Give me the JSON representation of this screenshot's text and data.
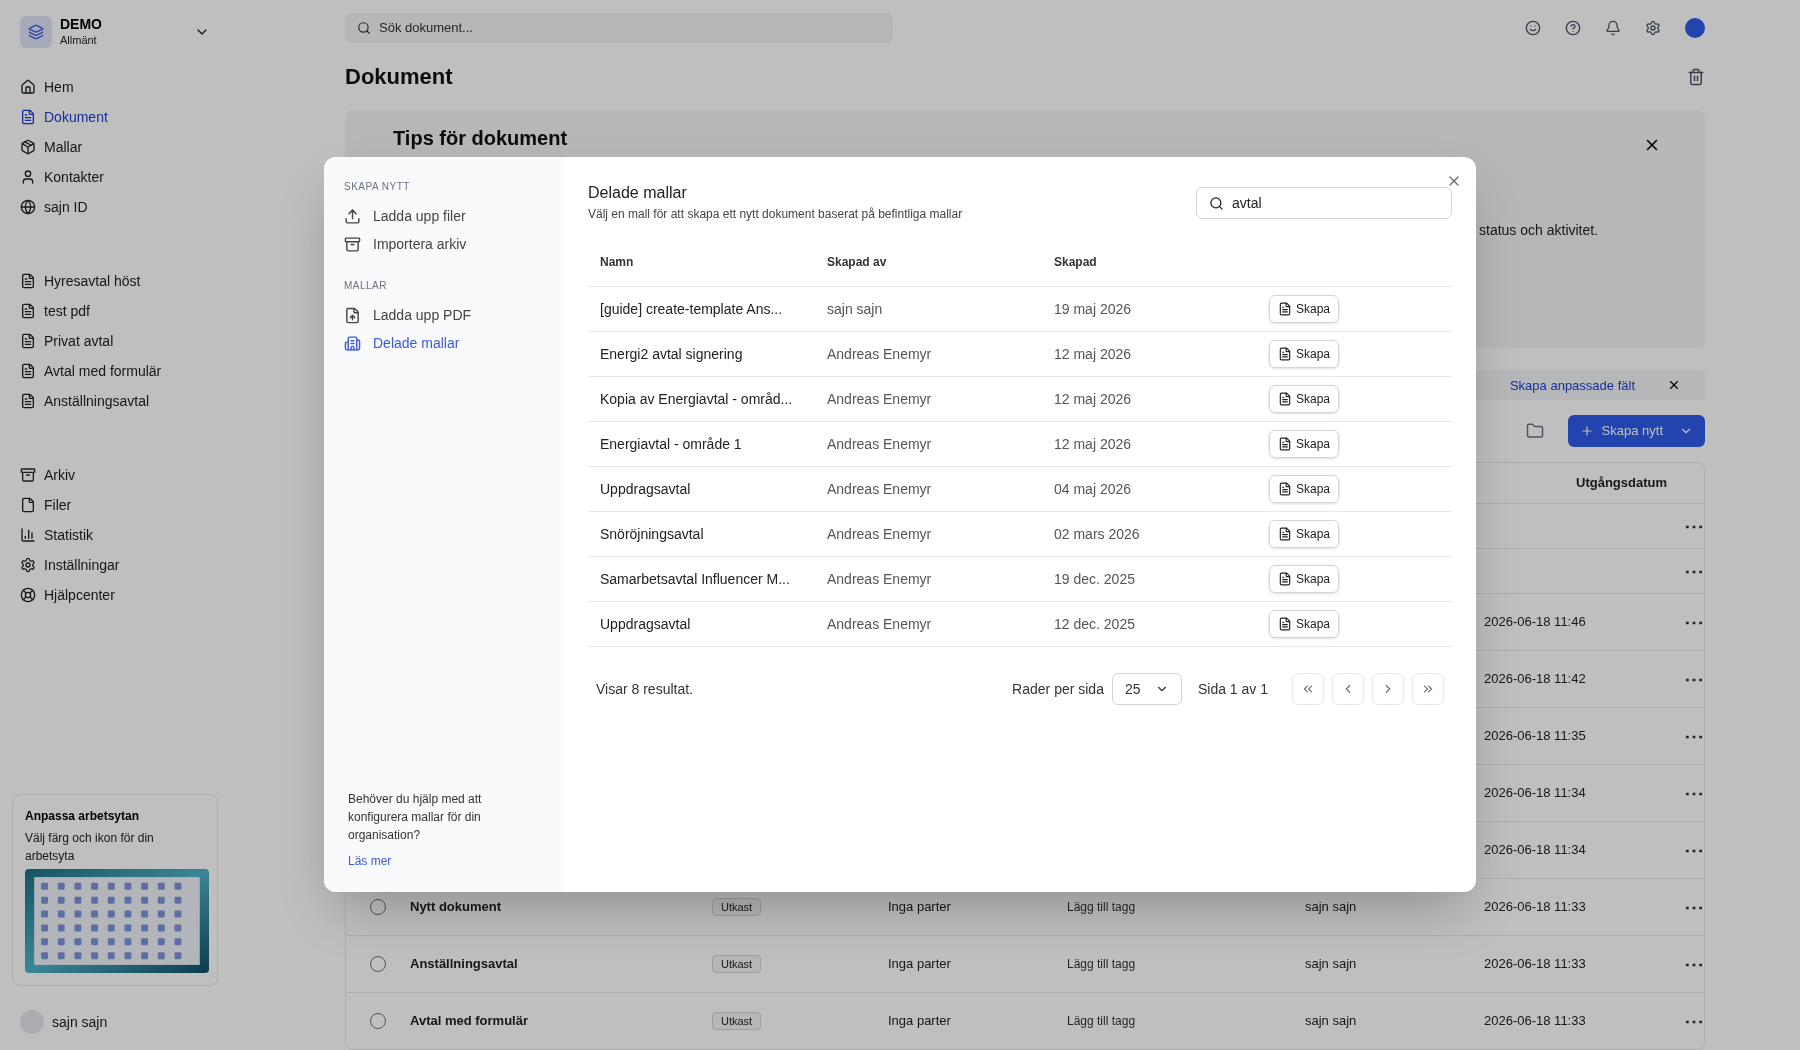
{
  "sidebar": {
    "workspace": {
      "name": "DEMO",
      "subtitle": "Allmänt"
    },
    "nav": [
      {
        "label": "Hem",
        "selected": false
      },
      {
        "label": "Dokument",
        "selected": true
      },
      {
        "label": "Mallar",
        "selected": false
      },
      {
        "label": "Kontakter",
        "selected": false
      },
      {
        "label": "sajn ID",
        "selected": false
      }
    ],
    "recent": [
      "Hyresavtal höst",
      "test pdf",
      "Privat avtal",
      "Avtal med formulär",
      "Anställningsavtal"
    ],
    "other": [
      "Arkiv",
      "Filer",
      "Statistik",
      "Inställningar",
      "Hjälpcenter"
    ],
    "promo": {
      "title": "Anpassa arbetsytan",
      "text": "Välj färg och ikon för din arbetsyta"
    },
    "user": "sajn sajn"
  },
  "topbar": {
    "search_placeholder": "Sök dokument..."
  },
  "page": {
    "title": "Dokument",
    "tips": {
      "title": "Tips för dokument",
      "text": "status och aktivitet."
    },
    "notice": {
      "link": "Skapa anpassade fält"
    },
    "create_button": "Skapa nytt",
    "table": {
      "column_header": "Utgångsdatum",
      "rows": [
        {
          "menu": "⋯"
        },
        {
          "menu": "⋯"
        },
        {
          "date": "2026-06-18 11:46",
          "menu": "⋯"
        },
        {
          "date": "2026-06-18 11:42",
          "menu": "⋯"
        },
        {
          "date": "2026-06-18 11:35",
          "menu": "⋯"
        },
        {
          "date": "2026-06-18 11:34",
          "menu": "⋯"
        },
        {
          "date": "2026-06-18 11:34",
          "menu": "⋯"
        },
        {
          "checked": false,
          "name": "Nytt dokument",
          "status": "Utkast",
          "parties": "Inga parter",
          "tags": "Lägg till tagg",
          "creator": "sajn sajn",
          "date": "2026-06-18 11:33",
          "menu": "⋯"
        },
        {
          "checked": false,
          "name": "Anställningsavtal",
          "status": "Utkast",
          "parties": "Inga parter",
          "tags": "Lägg till tagg",
          "creator": "sajn sajn",
          "date": "2026-06-18 11:33",
          "menu": "⋯"
        },
        {
          "checked": false,
          "name": "Avtal med formulär",
          "status": "Utkast",
          "parties": "Inga parter",
          "tags": "Lägg till tagg",
          "creator": "sajn sajn",
          "date": "2026-06-18 11:33",
          "menu": "⋯"
        }
      ]
    }
  },
  "modal": {
    "menu": [
      {
        "heading": "SKAPA NYTT",
        "items": [
          {
            "label": "Ladda upp filer",
            "selected": false
          },
          {
            "label": "Importera arkiv",
            "selected": false
          }
        ]
      },
      {
        "heading": "MALLAR",
        "items": [
          {
            "label": "Ladda upp PDF",
            "selected": false
          },
          {
            "label": "Delade mallar",
            "selected": true
          }
        ]
      }
    ],
    "help": {
      "text": "Behöver du hjälp med att konfigurera mallar för din organisation?",
      "link": "Läs mer"
    },
    "title": "Delade mallar",
    "subtitle": "Välj en mall för att skapa ett nytt dokument baserat på befintliga mallar",
    "search": {
      "value": "avtal"
    },
    "columns": [
      "Namn",
      "Skapad av",
      "Skapad"
    ],
    "rows": [
      {
        "name": "[guide] create-template Ans...",
        "creator": "sajn sajn",
        "created": "19 maj 2026",
        "action": "Skapa"
      },
      {
        "name": "Energi2 avtal signering",
        "creator": "Andreas Enemyr",
        "created": "12 maj 2026",
        "action": "Skapa"
      },
      {
        "name": "Kopia av Energiavtal - områd...",
        "creator": "Andreas Enemyr",
        "created": "12 maj 2026",
        "action": "Skapa"
      },
      {
        "name": "Energiavtal - område 1",
        "creator": "Andreas Enemyr",
        "created": "12 maj 2026",
        "action": "Skapa"
      },
      {
        "name": "Uppdragsavtal",
        "creator": "Andreas Enemyr",
        "created": "04 maj 2026",
        "action": "Skapa"
      },
      {
        "name": "Snöröjningsavtal",
        "creator": "Andreas Enemyr",
        "created": "02 mars 2026",
        "action": "Skapa"
      },
      {
        "name": "Samarbetsavtal Influencer M...",
        "creator": "Andreas Enemyr",
        "created": "19 dec. 2025",
        "action": "Skapa"
      },
      {
        "name": "Uppdragsavtal",
        "creator": "Andreas Enemyr",
        "created": "12 dec. 2025",
        "action": "Skapa"
      }
    ],
    "footer": {
      "results": "Visar 8 resultat.",
      "rows_label": "Rader per sida",
      "rows_value": "25",
      "page": "Sida 1 av 1"
    }
  }
}
